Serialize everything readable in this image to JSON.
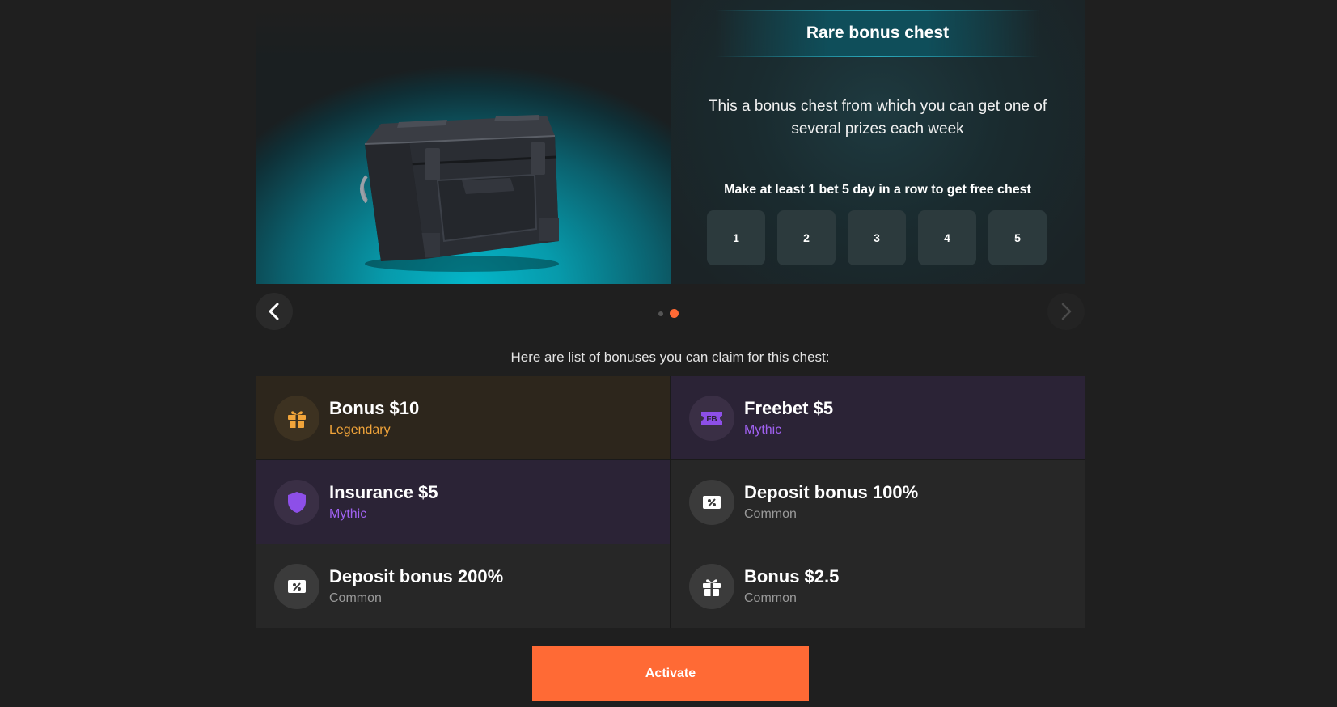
{
  "banner": {
    "title": "Rare bonus chest",
    "description": "This a bonus chest from which you can get one of several prizes each week",
    "rule": "Make at least 1 bet 5 day in a row to get free chest",
    "days": [
      "1",
      "2",
      "3",
      "4",
      "5"
    ],
    "image_icon": "chest-image"
  },
  "carousel": {
    "prev_icon": "chevron-left-icon",
    "next_icon": "chevron-right-icon",
    "active_slide": 2,
    "slide_count": 2
  },
  "list_heading": "Here are list of bonuses you can claim for this chest:",
  "bonuses": [
    {
      "name": "Bonus $10",
      "rarity": "Legendary",
      "icon": "gift-icon"
    },
    {
      "name": "Freebet $5",
      "rarity": "Mythic",
      "icon": "freebet-icon",
      "icon_text": "FB"
    },
    {
      "name": "Insurance $5",
      "rarity": "Mythic",
      "icon": "shield-icon"
    },
    {
      "name": "Deposit bonus 100%",
      "rarity": "Common",
      "icon": "percent-ticket-icon"
    },
    {
      "name": "Deposit bonus 200%",
      "rarity": "Common",
      "icon": "percent-ticket-icon"
    },
    {
      "name": "Bonus $2.5",
      "rarity": "Common",
      "icon": "gift-icon"
    }
  ],
  "activate_label": "Activate",
  "colors": {
    "accent": "#ff6a35",
    "legendary": "#f1a43a",
    "mythic": "#a061f0",
    "common": "#9a9a9a",
    "teal": "#04b6c9"
  }
}
